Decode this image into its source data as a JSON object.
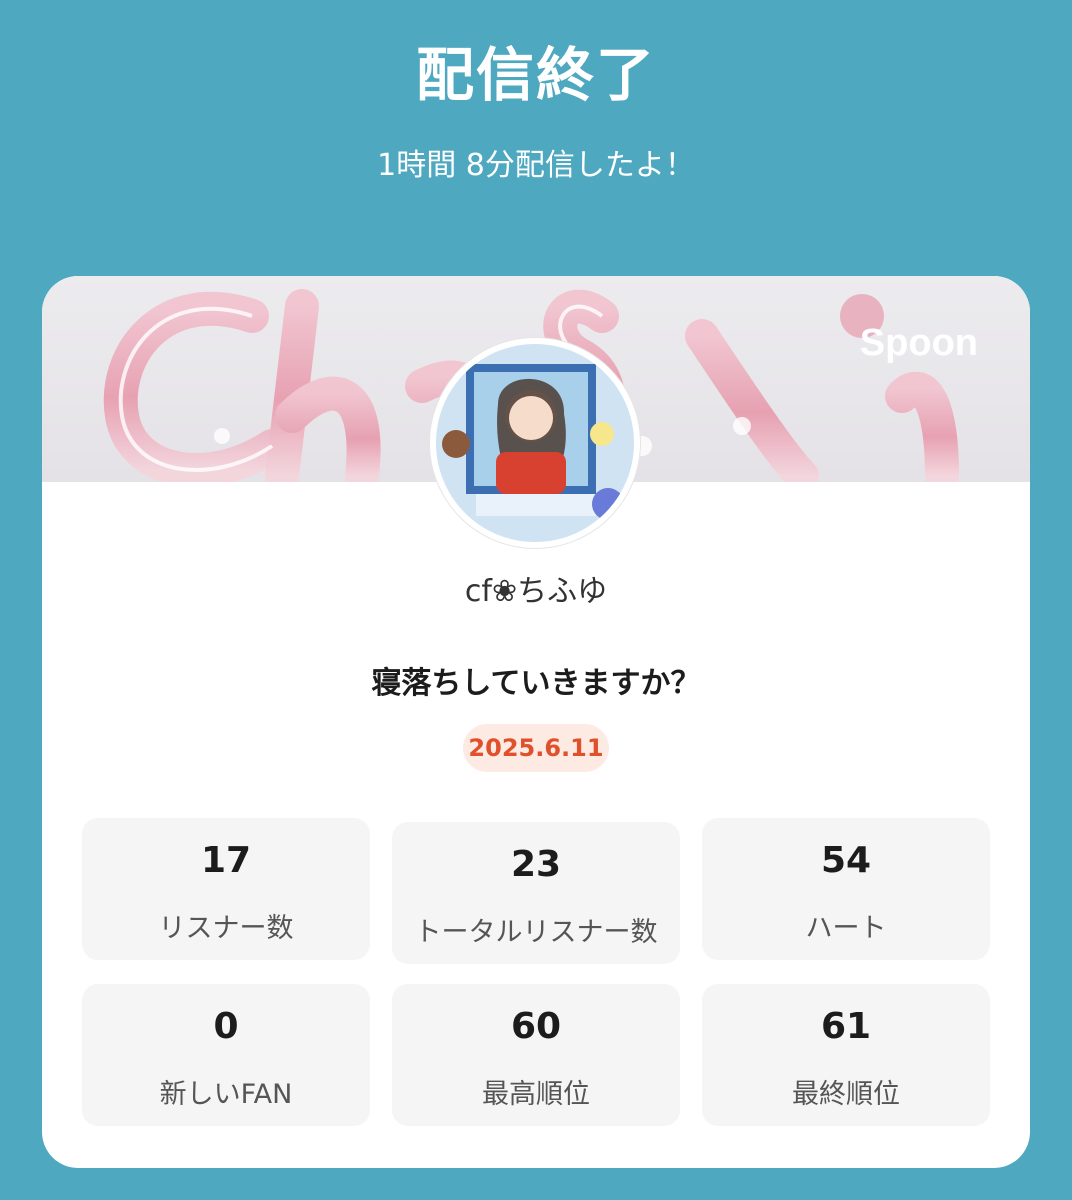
{
  "header": {
    "title": "配信終了",
    "subtitle": "1時間 8分配信したよ！"
  },
  "card": {
    "brand": "Spoon",
    "banner_text": "Chifuyu",
    "username": "cf❀ちふゆ",
    "question": "寝落ちしていきますか？",
    "date": "2025.6.11",
    "colors": {
      "background": "#4ea8bf",
      "date_text": "#e0502a",
      "date_badge": "#fdeae3",
      "banner_accent": "#e79aac"
    }
  },
  "stats": [
    {
      "value": "17",
      "label": "リスナー数"
    },
    {
      "value": "23",
      "label": "トータルリスナー数"
    },
    {
      "value": "54",
      "label": "ハート"
    },
    {
      "value": "0",
      "label": "新しいFAN"
    },
    {
      "value": "60",
      "label": "最高順位"
    },
    {
      "value": "61",
      "label": "最終順位"
    }
  ]
}
